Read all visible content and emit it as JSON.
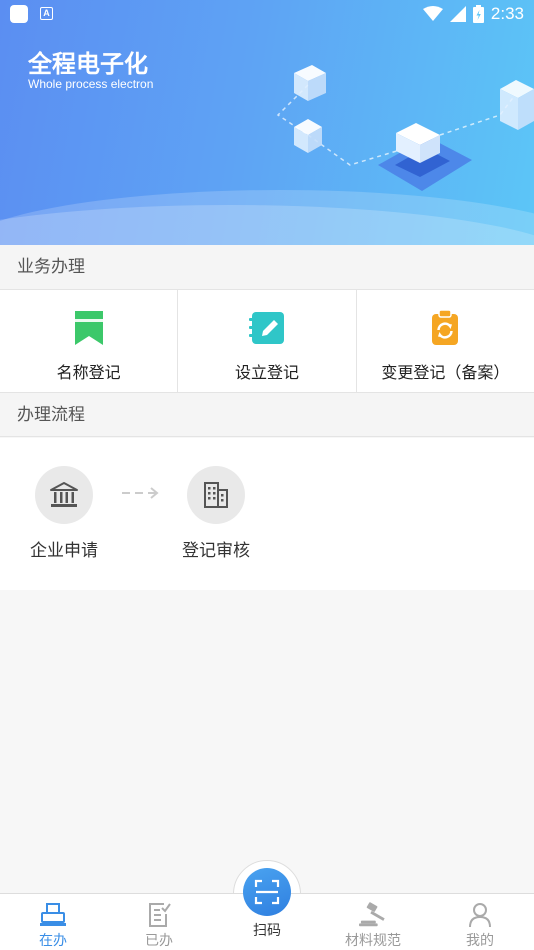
{
  "status_bar": {
    "time": "2:33",
    "notif_badge": "A"
  },
  "banner": {
    "title": "全程电子化",
    "subtitle": "Whole process electron"
  },
  "sections": {
    "business": {
      "title": "业务办理",
      "items": [
        {
          "label": "名称登记",
          "icon": "bookmark-icon",
          "color": "#3cc86a"
        },
        {
          "label": "设立登记",
          "icon": "notebook-pen-icon",
          "color": "#2fc6c8"
        },
        {
          "label": "变更登记（备案）",
          "icon": "clipboard-refresh-icon",
          "color": "#f5a623"
        }
      ]
    },
    "process": {
      "title": "办理流程",
      "steps": [
        {
          "label": "企业申请",
          "icon": "bank-building-icon"
        },
        {
          "label": "登记审核",
          "icon": "office-building-icon"
        }
      ]
    }
  },
  "bottom_nav": {
    "items": [
      {
        "label": "在办",
        "icon": "printer-icon",
        "active": true
      },
      {
        "label": "已办",
        "icon": "document-check-icon",
        "active": false
      },
      {
        "label": "扫码",
        "icon": "scan-icon",
        "active": false
      },
      {
        "label": "材料规范",
        "icon": "gavel-icon",
        "active": false
      },
      {
        "label": "我的",
        "icon": "person-icon",
        "active": false
      }
    ],
    "active_color": "#3a8ee6"
  }
}
